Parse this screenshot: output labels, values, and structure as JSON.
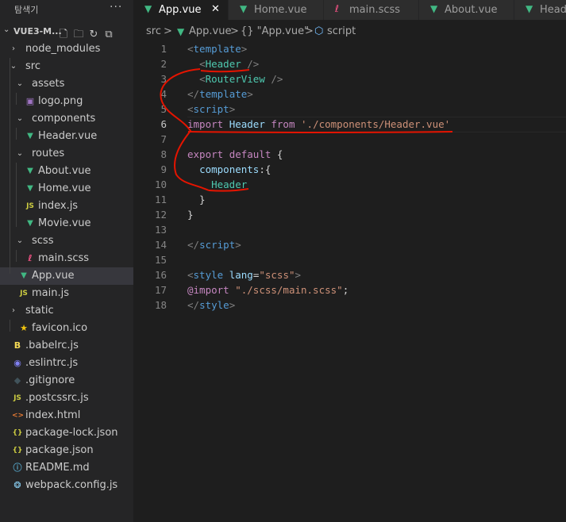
{
  "sidebar": {
    "title": "탐색기",
    "more": "···",
    "root_name": "VUE3-M...",
    "items": [
      {
        "label": "node_modules",
        "icon": "",
        "kind": "folder-closed"
      },
      {
        "label": "src",
        "icon": "",
        "kind": "folder-open"
      },
      {
        "label": "assets",
        "icon": "",
        "kind": "folder-open"
      },
      {
        "label": "logo.png",
        "icon": "▣",
        "kind": "file"
      },
      {
        "label": "components",
        "icon": "",
        "kind": "folder-open"
      },
      {
        "label": "Header.vue",
        "icon": "V",
        "kind": "file"
      },
      {
        "label": "routes",
        "icon": "",
        "kind": "folder-open"
      },
      {
        "label": "About.vue",
        "icon": "V",
        "kind": "file"
      },
      {
        "label": "Home.vue",
        "icon": "V",
        "kind": "file"
      },
      {
        "label": "index.js",
        "icon": "JS",
        "kind": "file"
      },
      {
        "label": "Movie.vue",
        "icon": "V",
        "kind": "file"
      },
      {
        "label": "scss",
        "icon": "",
        "kind": "folder-open"
      },
      {
        "label": "main.scss",
        "icon": "ℓ",
        "kind": "file"
      },
      {
        "label": "App.vue",
        "icon": "V",
        "kind": "file"
      },
      {
        "label": "main.js",
        "icon": "JS",
        "kind": "file"
      },
      {
        "label": "static",
        "icon": "",
        "kind": "folder-closed"
      },
      {
        "label": "favicon.ico",
        "icon": "★",
        "kind": "file"
      },
      {
        "label": ".babelrc.js",
        "icon": "B",
        "kind": "file"
      },
      {
        "label": ".eslintrc.js",
        "icon": "◉",
        "kind": "file"
      },
      {
        "label": ".gitignore",
        "icon": "◆",
        "kind": "file"
      },
      {
        "label": ".postcssrc.js",
        "icon": "JS",
        "kind": "file"
      },
      {
        "label": "index.html",
        "icon": "<>",
        "kind": "file"
      },
      {
        "label": "package-lock.json",
        "icon": "{}",
        "kind": "file"
      },
      {
        "label": "package.json",
        "icon": "{}",
        "kind": "file"
      },
      {
        "label": "README.md",
        "icon": "ⓘ",
        "kind": "file"
      },
      {
        "label": "webpack.config.js",
        "icon": "❂",
        "kind": "file"
      }
    ]
  },
  "tabs": [
    {
      "label": "App.vue",
      "icon": "V",
      "active": true,
      "close": "✕"
    },
    {
      "label": "Home.vue",
      "icon": "V"
    },
    {
      "label": "main.scss",
      "icon": "ℓ"
    },
    {
      "label": "About.vue",
      "icon": "V"
    },
    {
      "label": "Heade",
      "icon": "V"
    }
  ],
  "breadcrumb": {
    "src": "src",
    "file": "App.vue",
    "obj": "{} \"App.vue\"",
    "section": "script",
    "sep": ">"
  },
  "editor": {
    "current_line": 6,
    "lines": [
      [
        [
          "c-tag",
          "<"
        ],
        [
          "c-tagname",
          "template"
        ],
        [
          "c-tag",
          ">"
        ]
      ],
      [
        [
          "c-plain",
          "  "
        ],
        [
          "c-tag",
          "<"
        ],
        [
          "c-comp",
          "Header"
        ],
        [
          "c-plain",
          " "
        ],
        [
          "c-tag",
          "/>"
        ]
      ],
      [
        [
          "c-plain",
          "  "
        ],
        [
          "c-tag",
          "<"
        ],
        [
          "c-comp",
          "RouterView"
        ],
        [
          "c-plain",
          " "
        ],
        [
          "c-tag",
          "/>"
        ]
      ],
      [
        [
          "c-tag",
          "</"
        ],
        [
          "c-tagname",
          "template"
        ],
        [
          "c-tag",
          ">"
        ]
      ],
      [
        [
          "c-tag",
          "<"
        ],
        [
          "c-tagname",
          "script"
        ],
        [
          "c-tag",
          ">"
        ]
      ],
      [
        [
          "c-kw",
          "import"
        ],
        [
          "c-plain",
          " "
        ],
        [
          "c-var",
          "Header"
        ],
        [
          "c-plain",
          " "
        ],
        [
          "c-kw",
          "from"
        ],
        [
          "c-plain",
          " "
        ],
        [
          "c-str",
          "'./components/Header.vue'"
        ]
      ],
      [],
      [
        [
          "c-kw",
          "export"
        ],
        [
          "c-plain",
          " "
        ],
        [
          "c-kw",
          "default"
        ],
        [
          "c-plain",
          " {"
        ]
      ],
      [
        [
          "c-plain",
          "  "
        ],
        [
          "c-var",
          "components"
        ],
        [
          "c-plain",
          ":{"
        ]
      ],
      [
        [
          "c-plain",
          "    "
        ],
        [
          "c-comp",
          "Header"
        ]
      ],
      [
        [
          "c-plain",
          "  }"
        ]
      ],
      [
        [
          "c-plain",
          "}"
        ]
      ],
      [],
      [
        [
          "c-tag",
          "</"
        ],
        [
          "c-tagname",
          "script"
        ],
        [
          "c-tag",
          ">"
        ]
      ],
      [],
      [
        [
          "c-tag",
          "<"
        ],
        [
          "c-tagname",
          "style"
        ],
        [
          "c-plain",
          " "
        ],
        [
          "c-attr",
          "lang"
        ],
        [
          "c-plain",
          "="
        ],
        [
          "c-str",
          "\"scss\""
        ],
        [
          "c-tag",
          ">"
        ]
      ],
      [
        [
          "c-kw",
          "@import"
        ],
        [
          "c-plain",
          " "
        ],
        [
          "c-str",
          "\"./scss/main.scss\""
        ],
        [
          "c-plain",
          ";"
        ]
      ],
      [
        [
          "c-tag",
          "</"
        ],
        [
          "c-tagname",
          "style"
        ],
        [
          "c-tag",
          ">"
        ]
      ]
    ]
  },
  "colors": {
    "vue": "#41b883",
    "js": "#cbcb41",
    "scss": "#f55385",
    "png": "#a074c4",
    "annotation": "#e51400"
  }
}
